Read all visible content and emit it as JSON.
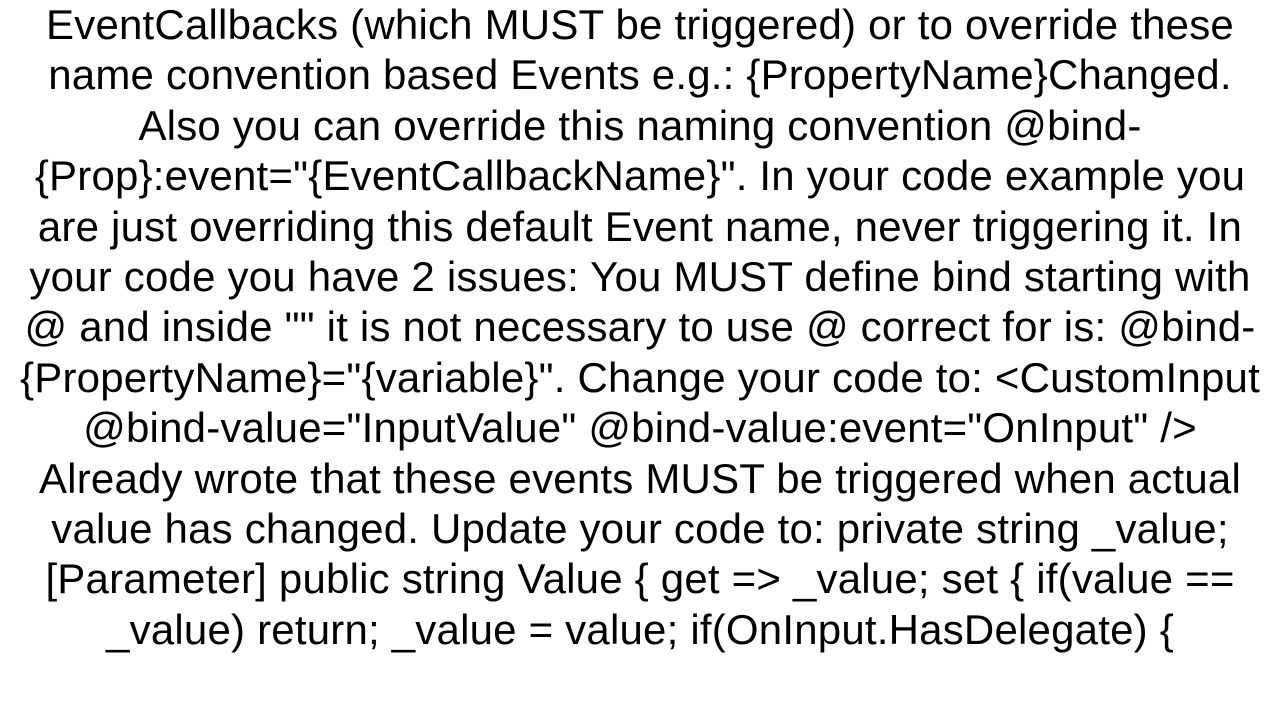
{
  "document": {
    "text": "EventCallbacks (which MUST be triggered) or to override these name convention based Events e.g.: {PropertyName}Changed. Also you can override this naming convention @bind-{Prop}:event=\"{EventCallbackName}\". In your code example you are just overriding this default Event name, never triggering it. In your code you have 2 issues:  You MUST define bind starting with @ and inside \"\" it is not necessary to use @ correct for is: @bind-{PropertyName}=\"{variable}\".  Change your code to: <CustomInput @bind-value=\"InputValue\" @bind-value:event=\"OnInput\" />  Already wrote that these events MUST be triggered when actual value has changed. Update your code to:  private string _value; [Parameter] public string Value  {     get => _value;     set    {        if(value == _value)         return;         _value = value;         if(OnInput.HasDelegate)        {"
  }
}
